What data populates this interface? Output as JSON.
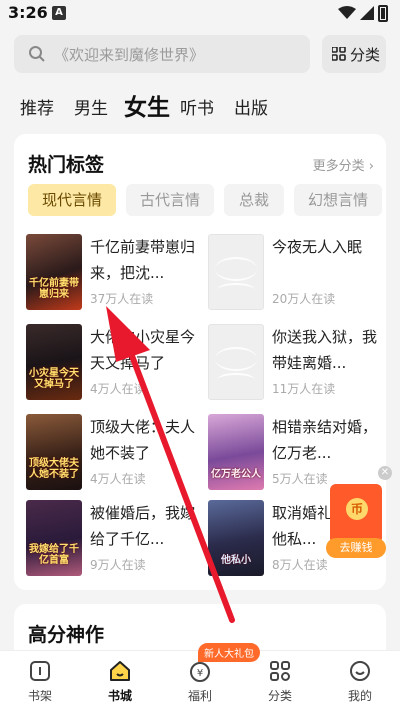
{
  "status": {
    "time": "3:26",
    "notif": "A"
  },
  "search": {
    "placeholder": "《欢迎来到魔修世界》"
  },
  "category_button": "分类",
  "tabs": [
    "推荐",
    "男生",
    "女生",
    "听书",
    "出版"
  ],
  "hot_tags": {
    "title": "热门标签",
    "more": "更多分类 ›",
    "chips": [
      "现代言情",
      "古代言情",
      "总裁",
      "幻想言情"
    ],
    "books": [
      {
        "title": "千亿前妻带崽归来，把沈...",
        "readers": "37万人在读",
        "cover_text": "千亿前妻带崽归来"
      },
      {
        "title": "今夜无人入眠",
        "readers": "20万人在读"
      },
      {
        "title": "大佬的小灾星今天又掉马了",
        "readers": "4万人在读",
        "cover_text": "小灾星今天又掉马了"
      },
      {
        "title": "你送我入狱，我带娃离婚...",
        "readers": "11万人在读"
      },
      {
        "title": "顶级大佬：夫人她不装了",
        "readers": "4万人在读",
        "cover_text": "顶级大佬夫人她不装了"
      },
      {
        "title": "相错亲结对婚，亿万老...",
        "readers": "5万人在读",
        "cover_text": "亿万老公人"
      },
      {
        "title": "被催婚后，我嫁给了千亿...",
        "readers": "9万人在读",
        "cover_text": "我嫁给了千亿首富"
      },
      {
        "title": "取消婚礼当晚，他私...",
        "readers": "8万人在读",
        "cover_text": "他私小"
      }
    ]
  },
  "high_score": {
    "title": "高分神作"
  },
  "float_ad": {
    "coin": "币",
    "cta": "去赚钱"
  },
  "nav": {
    "badge": "新人大礼包",
    "items": [
      "书架",
      "书城",
      "福利",
      "分类",
      "我的"
    ]
  },
  "colors": {
    "accent": "#fde9a5",
    "arrow": "#e8192c"
  }
}
